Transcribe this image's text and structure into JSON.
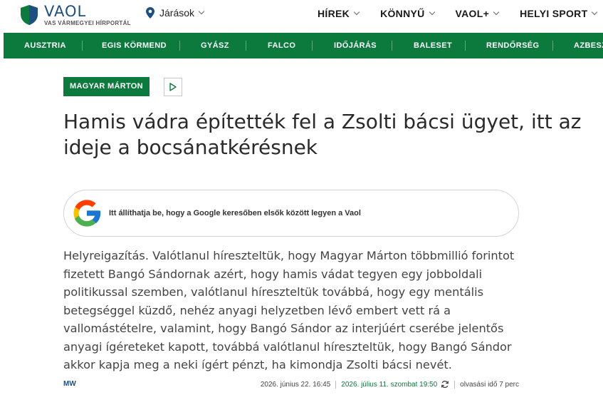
{
  "site": {
    "logo_title": "VAOL",
    "logo_subtitle": "VAS VÁRMEGYEI HÍRPORTÁL"
  },
  "header": {
    "location_label": "Járások",
    "nav": [
      {
        "label": "HÍREK"
      },
      {
        "label": "KÖNNYŰ"
      },
      {
        "label": "VAOL+"
      },
      {
        "label": "HELYI SPORT"
      }
    ]
  },
  "category_bar": {
    "items": [
      {
        "label": "AUSZTRIA"
      },
      {
        "label": "EGIS KÖRMEND"
      },
      {
        "label": "GYÁSZ"
      },
      {
        "label": "FALCO"
      },
      {
        "label": "IDŐJÁRÁS"
      },
      {
        "label": "BALESET"
      },
      {
        "label": "RENDŐRSÉG"
      },
      {
        "label": "AZBESZT"
      }
    ]
  },
  "article": {
    "tag": "MAGYAR MÁRTON",
    "title": "Hamis vádra építették fel a Zsolti bácsi ügyet, itt az ideje a bocsánatkérésnek",
    "google_banner_text": "Itt állíthatja be, hogy a Google keresőben elsők között legyen a Vaol",
    "lead": "Helyreigazítás. Valótlanul híreszteltük, hogy Magyar Márton többmillió forintot fizetett Bangó Sándornak azért, hogy hamis vádat tegyen egy jobboldali politikussal szemben, valótlanul híreszteltük továbbá, hogy egy mentális betegséggel küzdő, nehéz anyagi helyzetben lévő embert vett rá a vallomástételre, valamint, hogy Bangó Sándor az interjúért cserébe jelentős anyagi ígéreteket kapott, továbbá valótlanul híreszteltük, hogy Bangó Sándor akkor kapja meg a neki ígért pénzt, ha kimondja Zsolti bácsi nevét.",
    "author": "MW",
    "published": "2026. június 22. 16:45",
    "updated": "2026. július 11. szombat 19:50",
    "reading_time": "olvasási idő 7 perc"
  },
  "colors": {
    "brand_green": "#0b7a3c",
    "logo_blue": "#1d4f80"
  },
  "icons": {
    "logo": "shield-icon",
    "location": "map-pin-icon",
    "dropdown": "chevron-down-icon",
    "play": "play-icon",
    "google": "google-g-icon",
    "refresh": "refresh-icon"
  }
}
